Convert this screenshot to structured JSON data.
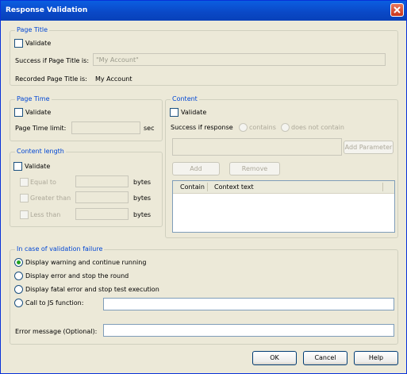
{
  "window": {
    "title": "Response Validation"
  },
  "page_title": {
    "legend": "Page Title",
    "validate_label": "Validate",
    "success_label": "Success if Page Title is:",
    "success_value": "\"My Account\"",
    "recorded_label": "Recorded Page Title is:",
    "recorded_value": "My Account"
  },
  "page_time": {
    "legend": "Page Time",
    "validate_label": "Validate",
    "limit_label": "Page Time limit:",
    "unit": "sec"
  },
  "content_length": {
    "legend": "Content length",
    "validate_label": "Validate",
    "equal_label": "Equal to",
    "greater_label": "Greater than",
    "less_label": "Less than",
    "unit": "bytes"
  },
  "content": {
    "legend": "Content",
    "validate_label": "Validate",
    "success_label": "Success if response",
    "contains_label": "contains",
    "not_contain_label": "does not contain",
    "add_parameter_label": "Add Parameter",
    "add_label": "Add",
    "remove_label": "Remove",
    "columns": [
      "Contain",
      "Context text"
    ]
  },
  "failure": {
    "legend": "In case of validation failure",
    "options": [
      "Display warning and continue running",
      "Display error and stop the round",
      "Display fatal error and stop test execution",
      "Call to JS function:"
    ],
    "error_message_label": "Error message (Optional):"
  },
  "buttons": {
    "ok": "OK",
    "cancel": "Cancel",
    "help": "Help"
  }
}
